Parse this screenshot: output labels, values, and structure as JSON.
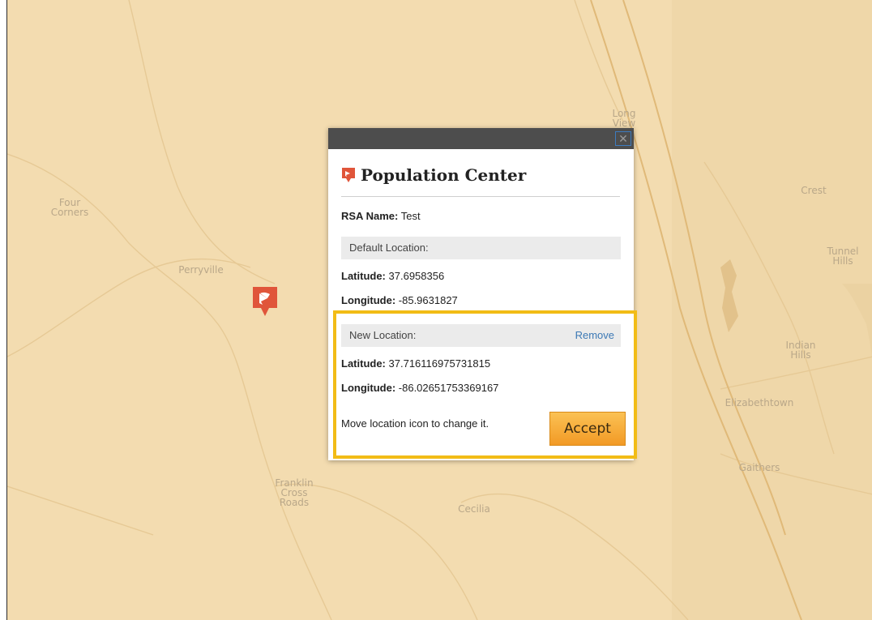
{
  "map": {
    "places": [
      {
        "id": "long-view",
        "label": "Long\nView"
      },
      {
        "id": "crest",
        "label": "Crest"
      },
      {
        "id": "four-corners",
        "label": "Four\nCorners"
      },
      {
        "id": "perryville",
        "label": "Perryville"
      },
      {
        "id": "tunnel-hills",
        "label": "Tunnel\nHills"
      },
      {
        "id": "indian-hills",
        "label": "Indian\nHills"
      },
      {
        "id": "elizabethtown",
        "label": "Elizabethtown"
      },
      {
        "id": "gaithers",
        "label": "Gaithers"
      },
      {
        "id": "franklin-cross-roads",
        "label": "Franklin\nCross\nRoads"
      },
      {
        "id": "cecilia",
        "label": "Cecilia"
      }
    ],
    "marker_icon": "location-flag-icon",
    "colors": {
      "land": "#f3dcb0",
      "roads": "#e8c78f",
      "marker": "#e0553a",
      "highlight": "#f2bc16"
    }
  },
  "popup": {
    "close_glyph": "✕",
    "title": "Population Center",
    "title_icon": "location-flag-icon",
    "rsa_name_label": "RSA Name:",
    "rsa_name_value": "Test",
    "default_section_label": "Default Location:",
    "default_latitude_label": "Latitude:",
    "default_latitude": "37.6958356",
    "default_longitude_label": "Longitude:",
    "default_longitude": "-85.9631827",
    "new_section_label": "New Location:",
    "remove_label": "Remove",
    "new_latitude_label": "Latitude:",
    "new_latitude": "37.716116975731815",
    "new_longitude_label": "Longitude:",
    "new_longitude": "-86.02651753369167",
    "hint": "Move location icon to change it.",
    "accept_label": "Accept"
  }
}
